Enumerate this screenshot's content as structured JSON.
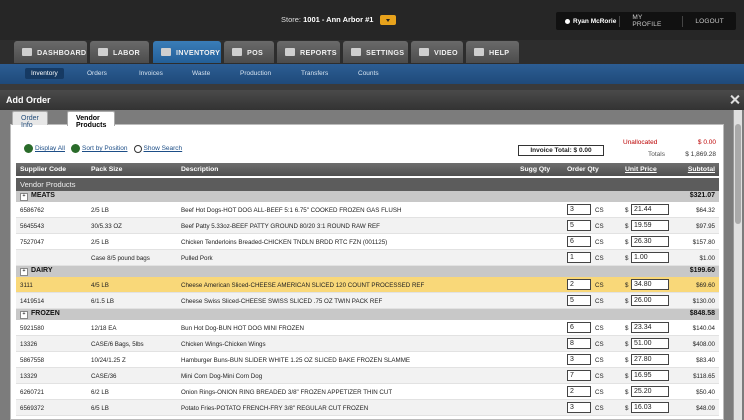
{
  "store": {
    "prefix": "Store:",
    "name": "1001 - Ann Arbor #1"
  },
  "user": {
    "name": "Ryan McRorie",
    "profile": "MY PROFILE",
    "logout": "LOGOUT"
  },
  "mainnav": [
    "DASHBOARD",
    "LABOR",
    "INVENTORY",
    "POS",
    "REPORTS",
    "SETTINGS",
    "VIDEO",
    "HELP"
  ],
  "subnav": [
    "Inventory",
    "Orders",
    "Invoices",
    "Waste",
    "Production",
    "Transfers",
    "Counts"
  ],
  "modal": {
    "title": "Add Order",
    "tabs": [
      "Order Info",
      "Vendor Products"
    ],
    "links": {
      "display_all": "Display All",
      "sort_position": "Sort by Position",
      "show_search": "Show Search"
    },
    "invoice_total": "Invoice Total: $ 0.00",
    "unallocated_label": "Unallocated",
    "unallocated_value": "$ 0.00",
    "totals_label": "Totals",
    "totals_value": "$ 1,869.28"
  },
  "grid": {
    "columns": [
      "Supplier Code",
      "Pack Size",
      "Description",
      "Sugg Qty",
      "Order Qty",
      "Unit Price",
      "Subtotal"
    ],
    "section": "Vendor Products",
    "categories": [
      {
        "name": "MEATS",
        "total": "$321.07",
        "rows": [
          {
            "code": "6586762",
            "pack": "2/5 LB",
            "desc": "Beef Hot Dogs-HOT DOG ALL-BEEF 5:1 6.75\" COOKED FROZEN GAS FLUSH",
            "qty": "3",
            "unit": "CS",
            "price": "21.44",
            "subtotal": "$64.32"
          },
          {
            "code": "5645543",
            "pack": "30/5.33 OZ",
            "desc": "Beef Patty 5.33oz-BEEF PATTY GROUND 80/20 3:1 ROUND RAW REF",
            "qty": "5",
            "unit": "CS",
            "price": "19.59",
            "subtotal": "$97.95"
          },
          {
            "code": "7527047",
            "pack": "2/5 LB",
            "desc": "Chicken Tenderloins Breaded-CHICKEN TNDLN BRDD RTC FZN (001125)",
            "qty": "6",
            "unit": "CS",
            "price": "26.30",
            "subtotal": "$157.80"
          },
          {
            "code": "",
            "pack": "Case 8/5 pound bags",
            "desc": "Pulled Pork",
            "qty": "1",
            "unit": "CS",
            "price": "1.00",
            "subtotal": "$1.00"
          }
        ]
      },
      {
        "name": "DAIRY",
        "total": "$199.60",
        "rows": [
          {
            "code": "3111",
            "pack": "4/5 LB",
            "desc": "Cheese American Sliced-CHEESE AMERICAN SLICED 120 COUNT PROCESSED REF",
            "qty": "2",
            "unit": "CS",
            "price": "34.80",
            "subtotal": "$69.60"
          },
          {
            "code": "1419514",
            "pack": "6/1.5 LB",
            "desc": "Cheese Swiss Sliced-CHEESE SWISS SLICED .75 OZ TWIN PACK REF",
            "qty": "5",
            "unit": "CS",
            "price": "26.00",
            "subtotal": "$130.00"
          }
        ]
      },
      {
        "name": "FROZEN",
        "total": "$848.58",
        "rows": [
          {
            "code": "5921580",
            "pack": "12/18 EA",
            "desc": "Bun Hot Dog-BUN HOT DOG MINI FROZEN",
            "qty": "6",
            "unit": "CS",
            "price": "23.34",
            "subtotal": "$140.04"
          },
          {
            "code": "13326",
            "pack": "CASE/6 Bags, 5lbs",
            "desc": "Chicken Wings-Chicken Wings",
            "qty": "8",
            "unit": "CS",
            "price": "51.00",
            "subtotal": "$408.00"
          },
          {
            "code": "5867558",
            "pack": "10/24/1.25 Z",
            "desc": "Hamburger Buns-BUN SLIDER WHITE 1.25 OZ SLICED BAKE FROZEN SLAMME",
            "qty": "3",
            "unit": "CS",
            "price": "27.80",
            "subtotal": "$83.40"
          },
          {
            "code": "13329",
            "pack": "CASE/36",
            "desc": "Mini Corn Dog-Mini Corn Dog",
            "qty": "7",
            "unit": "CS",
            "price": "16.95",
            "subtotal": "$118.65"
          },
          {
            "code": "6260721",
            "pack": "6/2 LB",
            "desc": "Onion Rings-ONION RING BREADED 3/8\" FROZEN APPETIZER THIN CUT",
            "qty": "2",
            "unit": "CS",
            "price": "25.20",
            "subtotal": "$50.40"
          },
          {
            "code": "6569372",
            "pack": "6/5 LB",
            "desc": "Potato Fries-POTATO FRENCH-FRY 3/8\" REGULAR CUT FROZEN",
            "qty": "3",
            "unit": "CS",
            "price": "16.03",
            "subtotal": "$48.09"
          }
        ]
      }
    ]
  }
}
